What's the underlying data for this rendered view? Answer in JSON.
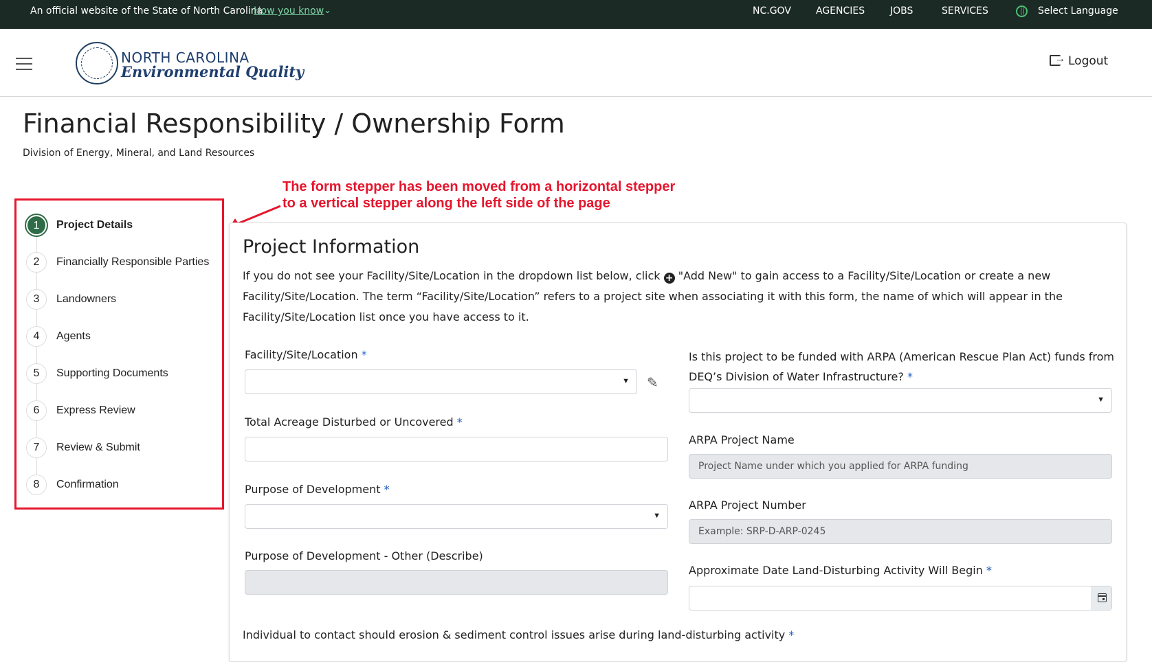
{
  "topbar": {
    "official_text": "An official website of the State of North Carolina",
    "how_you_know": "How you know",
    "links": [
      "NC.GOV",
      "AGENCIES",
      "JOBS",
      "SERVICES"
    ],
    "language": "Select Language"
  },
  "header": {
    "brand_line1": "NORTH CAROLINA",
    "brand_line2": "Environmental Quality",
    "logout": "Logout"
  },
  "page": {
    "title": "Financial Responsibility / Ownership Form",
    "subtitle": "Division of Energy, Mineral, and Land Resources"
  },
  "annotation": {
    "line1": "The form stepper has been moved from a horizontal stepper",
    "line2": "to a vertical stepper along the left side of the page"
  },
  "steps": [
    {
      "num": "1",
      "label": "Project Details"
    },
    {
      "num": "2",
      "label": "Financially Responsible Parties"
    },
    {
      "num": "3",
      "label": "Landowners"
    },
    {
      "num": "4",
      "label": "Agents"
    },
    {
      "num": "5",
      "label": "Supporting Documents"
    },
    {
      "num": "6",
      "label": "Express Review"
    },
    {
      "num": "7",
      "label": "Review & Submit"
    },
    {
      "num": "8",
      "label": "Confirmation"
    }
  ],
  "form": {
    "section_title": "Project Information",
    "intro_part1": "If you do not see your Facility/Site/Location in the dropdown list below, click",
    "intro_part2": "\"Add New\" to gain access to a Facility/Site/Location or create a new Facility/Site/Location. The term “Facility/Site/Location” refers to a project site when associating it with this form, the name of which will appear in the Facility/Site/Location list once you have access to it.",
    "facility_label": "Facility/Site/Location",
    "acreage_label": "Total Acreage Disturbed or Uncovered",
    "purpose_label": "Purpose of Development",
    "purpose_other_label": "Purpose of Development - Other (Describe)",
    "arpa_question_line1": "Is this project to be funded with ARPA (American Rescue Plan Act) funds from",
    "arpa_question_line2": "DEQ’s Division of Water Infrastructure?",
    "arpa_name_label": "ARPA Project Name",
    "arpa_name_placeholder": "Project Name under which you applied for ARPA funding",
    "arpa_number_label": "ARPA Project Number",
    "arpa_number_placeholder": "Example: SRP-D-ARP-0245",
    "date_label": "Approximate Date Land-Disturbing Activity Will Begin",
    "contact_label": "Individual to contact should erosion & sediment control issues arise during land-disturbing activity",
    "required_mark": "*"
  },
  "colors": {
    "topbar_bg": "#1b2a24",
    "active_step": "#2e6b47",
    "annotation_red": "#e5162d",
    "required_blue": "#1f5fbf"
  }
}
